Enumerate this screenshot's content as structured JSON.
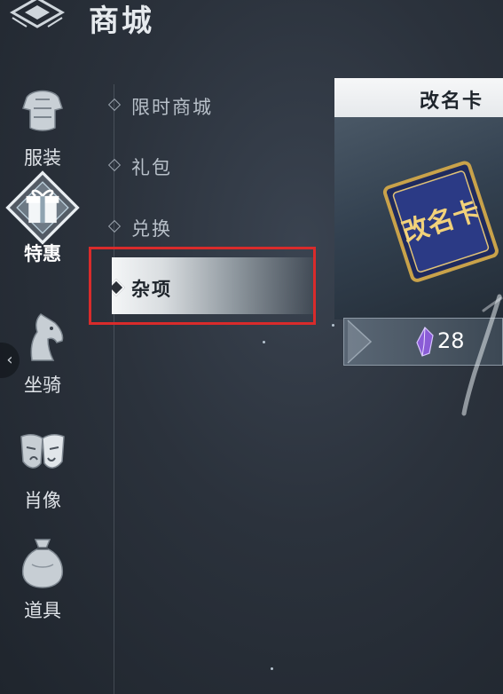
{
  "header": {
    "title": "商城",
    "logo_icon": "emblem-icon"
  },
  "rail": {
    "items": [
      {
        "label": "服装",
        "icon": "armor-icon",
        "active": false
      },
      {
        "label": "特惠",
        "icon": "gift-icon",
        "active": true
      },
      {
        "label": "坐骑",
        "icon": "horse-icon",
        "active": false
      },
      {
        "label": "肖像",
        "icon": "mask-icon",
        "active": false
      },
      {
        "label": "道具",
        "icon": "bag-icon",
        "active": false
      }
    ],
    "collapse_icon": "chevron-left-icon"
  },
  "submenu": {
    "items": [
      {
        "label": "限时商城",
        "active": false
      },
      {
        "label": "礼包",
        "active": false
      },
      {
        "label": "兑换",
        "active": false
      },
      {
        "label": "杂项",
        "active": true
      }
    ]
  },
  "product": {
    "name": "改名卡",
    "image_text": "改名卡",
    "price": "28",
    "currency_icon": "purple-gem-icon"
  },
  "colors": {
    "highlight_border": "#d92b2b",
    "accent_gem": "#8a5cd6"
  }
}
